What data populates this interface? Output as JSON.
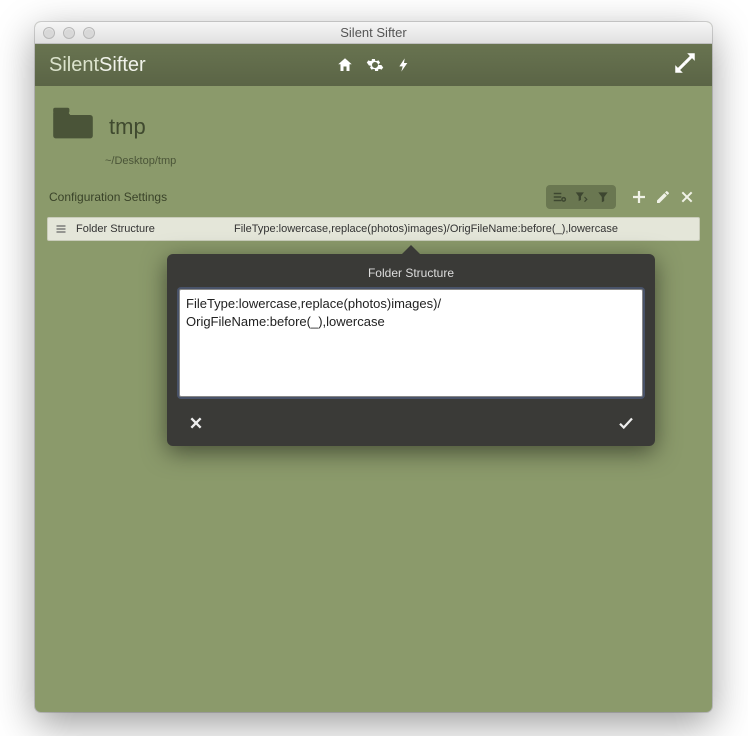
{
  "window": {
    "title": "Silent Sifter"
  },
  "brand": {
    "light": "Silent",
    "bold": "Sifter"
  },
  "folder": {
    "name": "tmp",
    "path": "~/Desktop/tmp"
  },
  "config": {
    "label": "Configuration Settings"
  },
  "rule": {
    "label": "Folder Structure",
    "value": "FileType:lowercase,replace(photos)images)/OrigFileName:before(_),lowercase"
  },
  "popover": {
    "title": "Folder Structure",
    "text": "FileType:lowercase,replace(photos)images)/\nOrigFileName:before(_),lowercase"
  }
}
